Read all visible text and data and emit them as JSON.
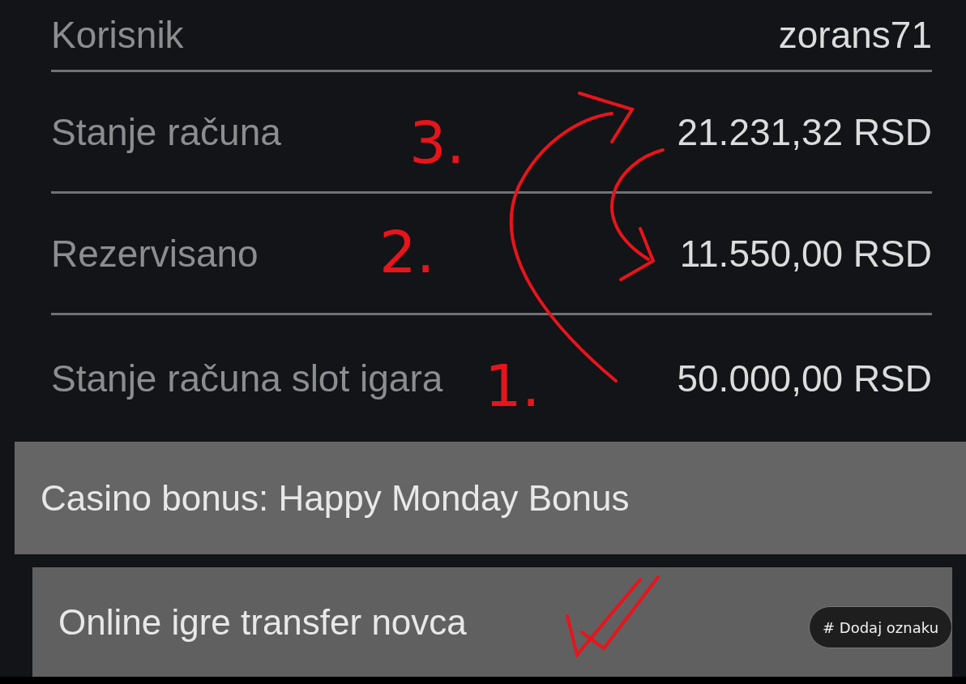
{
  "account_rows": [
    {
      "label": "Korisnik",
      "value": "zorans71"
    },
    {
      "label": "Stanje računa",
      "value": "21.231,32 RSD"
    },
    {
      "label": "Rezervisano",
      "value": "11.550,00 RSD"
    },
    {
      "label": "Stanje računa slot igara",
      "value": "50.000,00 RSD"
    }
  ],
  "annotations": [
    {
      "text": "3."
    },
    {
      "text": "2."
    },
    {
      "text": "1."
    }
  ],
  "casino_bonus": "Casino bonus: Happy Monday Bonus",
  "transfer_button": "Online igre transfer novca",
  "tag_button": "# Dodaj oznaku"
}
